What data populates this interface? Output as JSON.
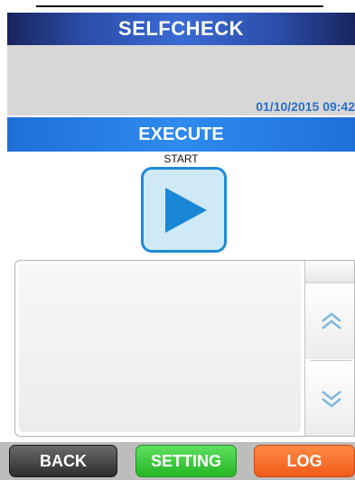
{
  "header": {
    "title": "SELFCHECK"
  },
  "info": {
    "datetime": "01/10/2015 09:42"
  },
  "section": {
    "title": "EXECUTE"
  },
  "start": {
    "label": "START",
    "icon": "play-icon"
  },
  "log": {
    "entries": []
  },
  "scroll": {
    "up_icon": "double-chevron-up-icon",
    "down_icon": "double-chevron-down-icon"
  },
  "footer": {
    "back_label": "BACK",
    "setting_label": "SETTING",
    "log_label": "LOG"
  },
  "colors": {
    "header": "#2b4da8",
    "section": "#2f8bee",
    "datetime": "#2a6fc9",
    "start_border": "#1f8bd8",
    "play": "#1a86d6",
    "back": "#2d2d2d",
    "setting": "#25b625",
    "log": "#f05a1a"
  }
}
